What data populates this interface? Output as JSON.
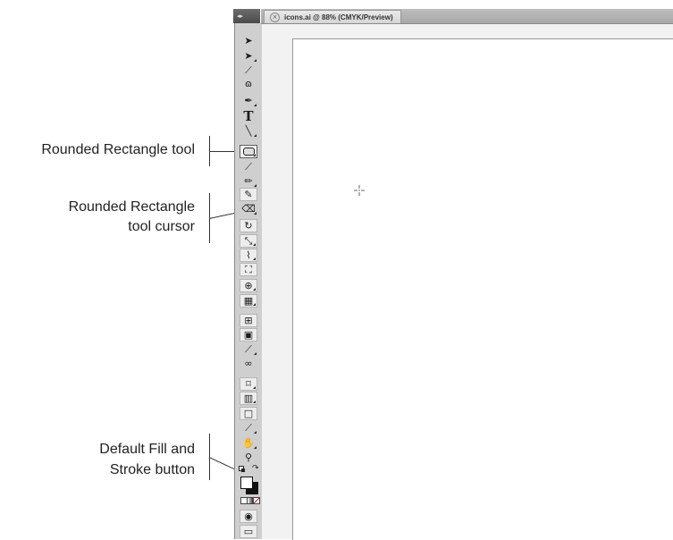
{
  "document": {
    "tab_title": "icons.ai @ 88% (CMYK/Preview)",
    "close_glyph": "×"
  },
  "callouts": {
    "rounded_rect_tool": "Rounded Rectangle tool",
    "cursor_line1": "Rounded Rectangle",
    "cursor_line2": "tool cursor",
    "default_fill_line1": "Default Fill and",
    "default_fill_line2": "Stroke button"
  },
  "toolbar": {
    "type_tool_glyph": "T"
  }
}
